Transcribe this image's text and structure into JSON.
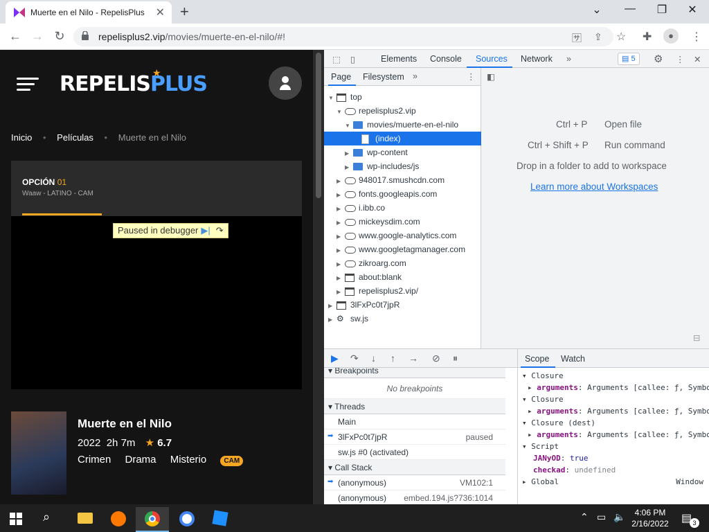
{
  "browser": {
    "tab_title": "Muerte en el Nilo - RepelisPlus",
    "url_host": "repelisplus2.vip",
    "url_path": "/movies/muerte-en-el-nilo/#!"
  },
  "site": {
    "logo_text": "REPELIS",
    "logo_plus": "PLUS",
    "breadcrumb": [
      "Inicio",
      "Películas",
      "Muerte en el Nilo"
    ],
    "option_label": "OPCIÓN",
    "option_number": "01",
    "option_sub": "Waaw - LATINO - CAM",
    "paused_text": "Paused in debugger",
    "movie_title": "Muerte en el Nilo",
    "year": "2022",
    "duration": "2h 7m",
    "rating": "6.7",
    "genres": [
      "Crimen",
      "Drama",
      "Misterio"
    ],
    "quality": "CAM"
  },
  "devtools": {
    "tabs": [
      "Elements",
      "Console",
      "Sources",
      "Network"
    ],
    "active_tab": "Sources",
    "issues_count": "5",
    "nav_tabs": [
      "Page",
      "Filesystem"
    ],
    "tree": [
      {
        "label": "top",
        "icon": "frame",
        "depth": 0,
        "arrow": "down"
      },
      {
        "label": "repelisplus2.vip",
        "icon": "cloud",
        "depth": 1,
        "arrow": "down"
      },
      {
        "label": "movies/muerte-en-el-nilo",
        "icon": "folder",
        "depth": 2,
        "arrow": "down"
      },
      {
        "label": "(index)",
        "icon": "file",
        "depth": 3,
        "arrow": "",
        "selected": true
      },
      {
        "label": "wp-content",
        "icon": "folder",
        "depth": 2,
        "arrow": "right"
      },
      {
        "label": "wp-includes/js",
        "icon": "folder",
        "depth": 2,
        "arrow": "right"
      },
      {
        "label": "948017.smushcdn.com",
        "icon": "cloud",
        "depth": 1,
        "arrow": "right"
      },
      {
        "label": "fonts.googleapis.com",
        "icon": "cloud",
        "depth": 1,
        "arrow": "right"
      },
      {
        "label": "i.ibb.co",
        "icon": "cloud",
        "depth": 1,
        "arrow": "right"
      },
      {
        "label": "mickeysdim.com",
        "icon": "cloud",
        "depth": 1,
        "arrow": "right"
      },
      {
        "label": "www.google-analytics.com",
        "icon": "cloud",
        "depth": 1,
        "arrow": "right"
      },
      {
        "label": "www.googletagmanager.com",
        "icon": "cloud",
        "depth": 1,
        "arrow": "right"
      },
      {
        "label": "zikroarg.com",
        "icon": "cloud",
        "depth": 1,
        "arrow": "right"
      },
      {
        "label": "about:blank",
        "icon": "frame",
        "depth": 1,
        "arrow": "right"
      },
      {
        "label": "repelisplus2.vip/",
        "icon": "frame",
        "depth": 1,
        "arrow": "right"
      },
      {
        "label": "3lFxPc0t7jpR",
        "icon": "frame",
        "depth": 0,
        "arrow": "right"
      },
      {
        "label": "sw.js",
        "icon": "gear",
        "depth": 0,
        "arrow": "right"
      }
    ],
    "shortcuts": [
      {
        "keys": "Ctrl + P",
        "action": "Open file"
      },
      {
        "keys": "Ctrl + Shift + P",
        "action": "Run command"
      }
    ],
    "drop_text": "Drop in a folder to add to workspace",
    "learn_link": "Learn more about Workspaces",
    "breakpoints_label": "Breakpoints",
    "no_breakpoints": "No breakpoints",
    "threads_label": "Threads",
    "threads": [
      {
        "name": "Main",
        "status": ""
      },
      {
        "name": "3lFxPc0t7jpR",
        "status": "paused"
      },
      {
        "name": "sw.js #0 (activated)",
        "status": ""
      }
    ],
    "call_stack_label": "Call Stack",
    "call_stack": [
      {
        "fn": "(anonymous)",
        "loc": "VM102:1"
      },
      {
        "fn": "(anonymous)",
        "loc": "embed.194.js?736:1014"
      }
    ],
    "scope_tabs": [
      "Scope",
      "Watch"
    ],
    "scope": [
      {
        "type": "head",
        "text": "Closure"
      },
      {
        "type": "prop",
        "key": "arguments",
        "val": "Arguments [callee: ƒ, Symbol"
      },
      {
        "type": "head",
        "text": "Closure"
      },
      {
        "type": "prop",
        "key": "arguments",
        "val": "Arguments [callee: ƒ, Symbol"
      },
      {
        "type": "head",
        "text": "Closure (dest)"
      },
      {
        "type": "prop",
        "key": "arguments",
        "val": "Arguments [callee: ƒ, Symbol"
      },
      {
        "type": "head",
        "text": "Script"
      },
      {
        "type": "leaf",
        "key": "JANyOD",
        "val": "true"
      },
      {
        "type": "leaf",
        "key": "checkad",
        "val": "undefined"
      },
      {
        "type": "global",
        "text": "Global",
        "right": "Window"
      }
    ]
  },
  "taskbar": {
    "time": "4:06 PM",
    "date": "2/16/2022",
    "notifications": "3"
  }
}
